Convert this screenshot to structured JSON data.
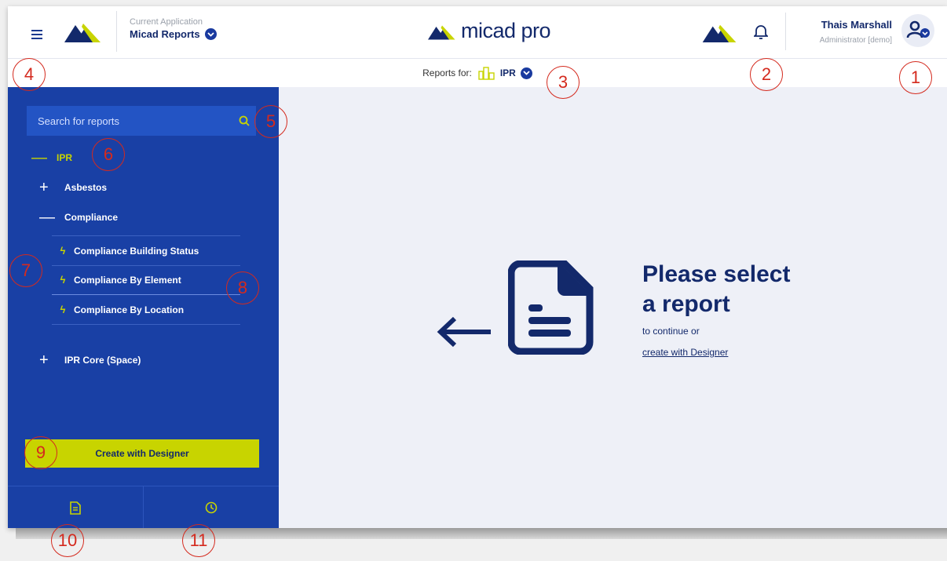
{
  "header": {
    "current_app_caption": "Current Application",
    "current_app_name": "Micad Reports",
    "brand_name": "micad pro",
    "user_name": "Thais Marshall",
    "user_role": "Administrator [demo]"
  },
  "reports_bar": {
    "label": "Reports for:",
    "selected": "IPR"
  },
  "sidebar": {
    "search_placeholder": "Search for reports",
    "tree": {
      "root": "IPR",
      "asbestos": "Asbestos",
      "compliance": "Compliance",
      "compliance_items": [
        "Compliance Building Status",
        "Compliance By Element",
        "Compliance By Location"
      ],
      "ipr_core": "IPR Core (Space)"
    },
    "create_button": "Create with Designer"
  },
  "main": {
    "title_line1": "Please select",
    "title_line2": "a report",
    "subtitle": "to continue or",
    "link": "create with Designer"
  },
  "annotations": [
    "1",
    "2",
    "3",
    "4",
    "5",
    "6",
    "7",
    "8",
    "9",
    "10",
    "11"
  ],
  "colors": {
    "sidebar": "#1940a5",
    "accent": "#c8d400",
    "brand": "#13296b",
    "annotation": "#d42a1e"
  }
}
